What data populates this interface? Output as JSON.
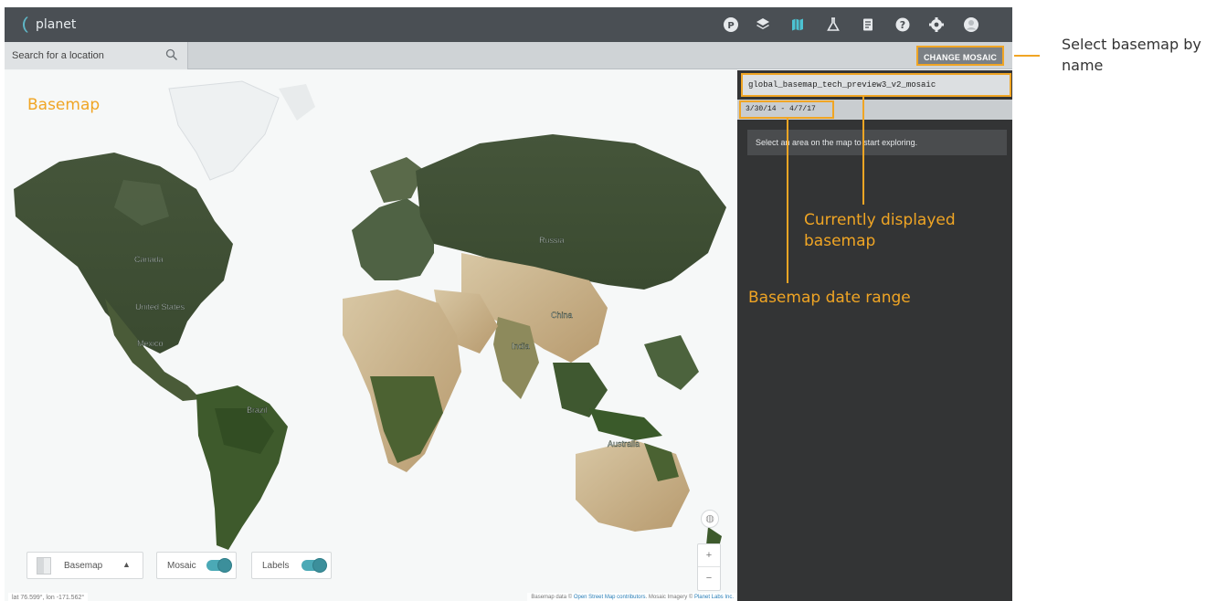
{
  "app": {
    "logo_text": "planet",
    "toolbar_icons": [
      "user-badge-icon",
      "layers-icon",
      "basemap-icon",
      "lab-flask-icon",
      "document-icon",
      "help-icon",
      "settings-icon",
      "account-icon"
    ],
    "user_badge_letter": "P"
  },
  "search": {
    "placeholder": "Search for a location"
  },
  "toolbar": {
    "change_mosaic_label": "CHANGE MOSAIC"
  },
  "panel": {
    "mosaic_name": "global_basemap_tech_preview3_v2_mosaic",
    "date_range": "3/30/14 - 4/7/17",
    "hint": "Select an area on the map to start exploring."
  },
  "map": {
    "country_labels": [
      "Russia",
      "Canada",
      "United States",
      "Mexico",
      "China",
      "India",
      "Brazil",
      "Australia"
    ],
    "controls": {
      "basemap_label": "Basemap",
      "mosaic_label": "Mosaic",
      "labels_label": "Labels",
      "mosaic_on": true,
      "labels_on": true,
      "zoom_in": "+",
      "zoom_out": "−"
    },
    "coords": "lat 76.599°, lon -171.562°",
    "attribution_prefix": "Basemap data © ",
    "attribution_osm": "Open Street Map contributors",
    "attribution_mid": ". Mosaic Imagery © ",
    "attribution_planet": "Planet Labs Inc."
  },
  "annotations": {
    "basemap": "Basemap",
    "currently_displayed": "Currently displayed basemap",
    "date_range": "Basemap date range",
    "select_by_name": "Select basemap by name"
  },
  "colors": {
    "annotation": "#f0a524",
    "toggle": "#4ba9b6",
    "topbar": "#4a4f54",
    "panel": "#333435"
  }
}
